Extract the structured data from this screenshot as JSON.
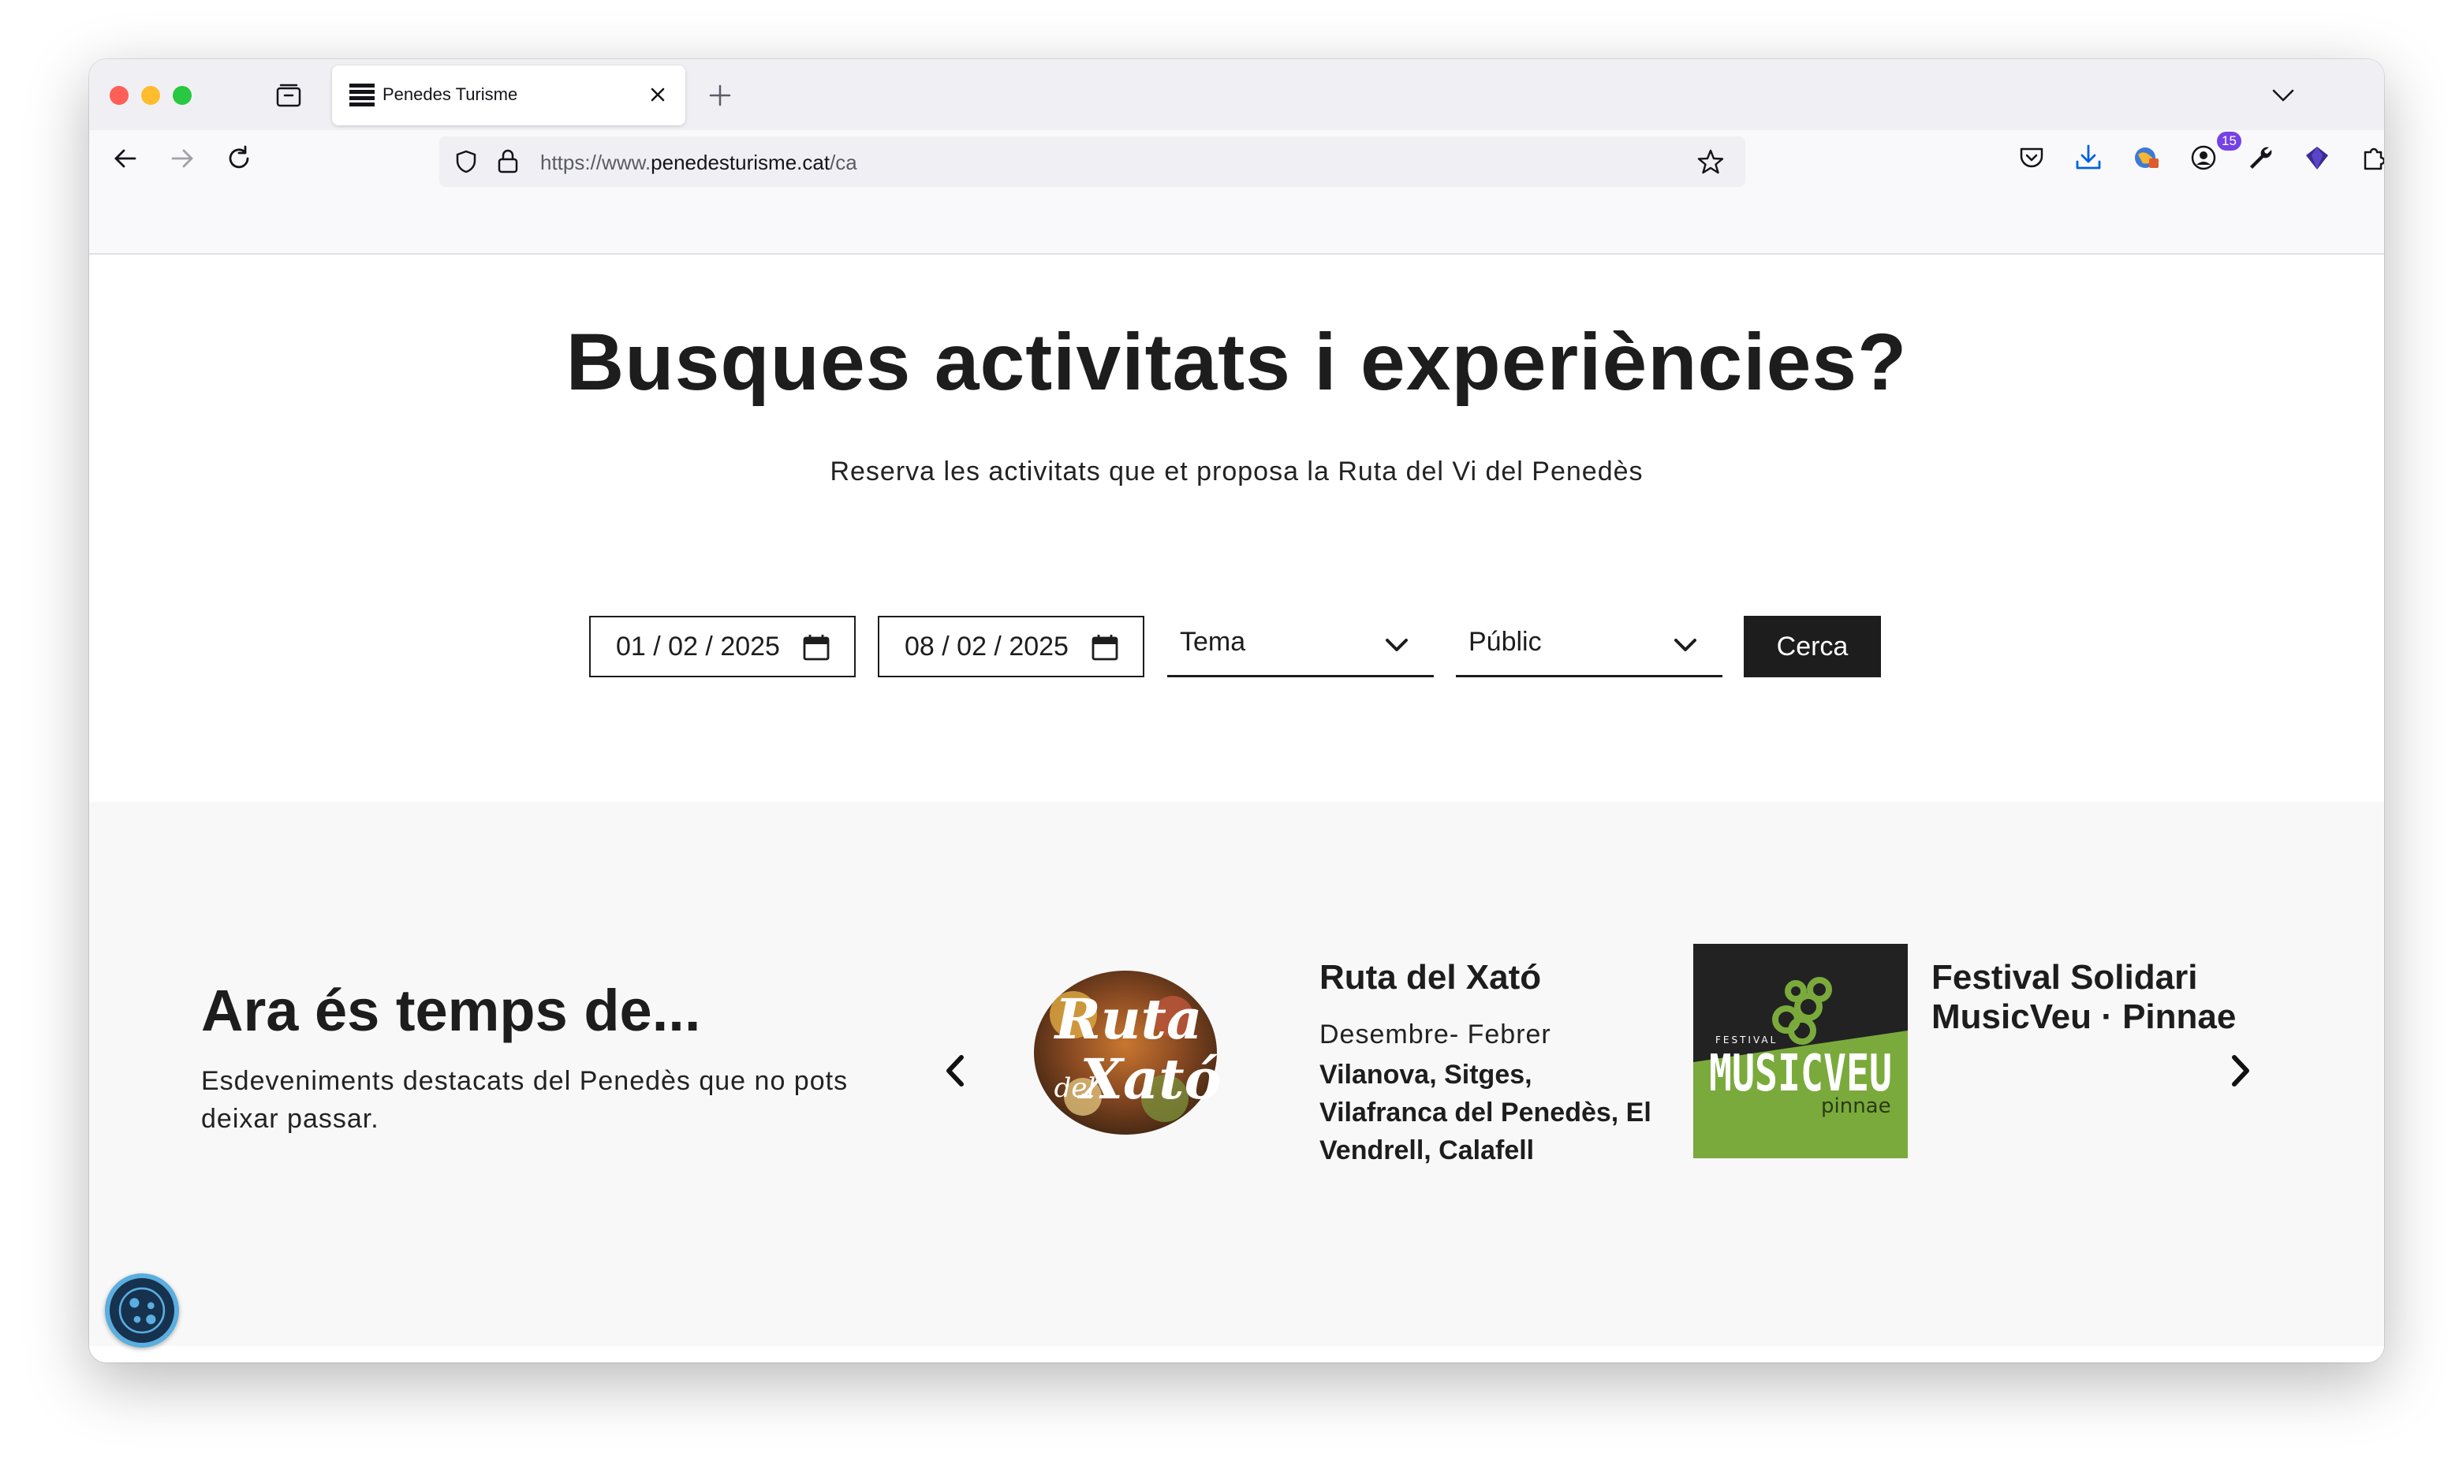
{
  "browser": {
    "tab": {
      "title": "Penedes Turisme"
    },
    "url": {
      "prefix": "https://www.",
      "domain": "penedesturisme.cat",
      "path": "/ca"
    },
    "extensions_badge": "15"
  },
  "hero": {
    "title": "Busques activitats i experiències?",
    "subtitle": "Reserva les activitats que et proposa la Ruta del Vi del Penedès"
  },
  "filters": {
    "date_from": "01 / 02 / 2025",
    "date_to": "08 / 02 / 2025",
    "theme_label": "Tema",
    "audience_label": "Públic",
    "search_label": "Cerca"
  },
  "featured": {
    "title": "Ara és temps de...",
    "description": "Esdeveniments destacats del Penedès que no pots deixar passar.",
    "cards": [
      {
        "title": "Ruta del Xató",
        "dates": "Desembre- Febrer",
        "places": "Vilanova, Sitges, Vilafranca del Penedès, El Vendrell, Calafell",
        "logo_text": [
          "Ruta",
          "del",
          "Xató"
        ]
      },
      {
        "title": "Festival Solidari MusicVeu · Pinnae",
        "logo_text": [
          "FESTIVAL",
          "MUSICVEU",
          "pinnae"
        ]
      }
    ]
  },
  "colors": {
    "text_dark": "#1d1d1d",
    "musicveu_green": "#7aaa3c",
    "musicveu_dark": "#222222",
    "cookie_blue": "#5aaee0"
  }
}
